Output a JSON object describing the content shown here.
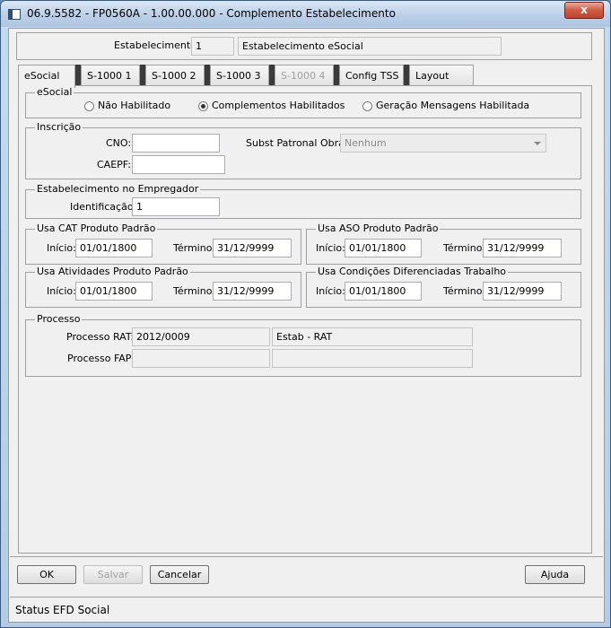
{
  "window": {
    "title": "06.9.5582 - FP0560A - 1.00.00.000 - Complemento Estabelecimento",
    "close_glyph": "x"
  },
  "header": {
    "estabelecimento_label": "Estabelecimento:",
    "estabelecimento_code": "1",
    "estabelecimento_name": "Estabelecimento eSocial"
  },
  "tabs": [
    {
      "label": "eSocial",
      "active": true,
      "disabled": false
    },
    {
      "label": "S-1000 1",
      "active": false,
      "disabled": false
    },
    {
      "label": "S-1000 2",
      "active": false,
      "disabled": false
    },
    {
      "label": "S-1000 3",
      "active": false,
      "disabled": false
    },
    {
      "label": "S-1000 4",
      "active": false,
      "disabled": true
    },
    {
      "label": "Config TSS",
      "active": false,
      "disabled": false
    },
    {
      "label": "Layout",
      "active": false,
      "disabled": false
    }
  ],
  "esocial_group": {
    "title": "eSocial",
    "options": [
      {
        "label": "Não Habilitado",
        "checked": false
      },
      {
        "label": "Complementos Habilitados",
        "checked": true
      },
      {
        "label": "Geração Mensagens Habilitada",
        "checked": false
      }
    ]
  },
  "inscricao": {
    "title": "Inscrição",
    "cno_label": "CNO:",
    "cno_value": "",
    "caepf_label": "CAEPF:",
    "caepf_value": "",
    "subst_label": "Subst Patronal Obra:",
    "subst_value": "Nenhum"
  },
  "empregador": {
    "title": "Estabelecimento no Empregador",
    "identificacao_label": "Identificação:",
    "identificacao_value": "1"
  },
  "cat": {
    "title": "Usa CAT Produto Padrão",
    "inicio_label": "Início:",
    "inicio": "01/01/1800",
    "termino_label": "Término:",
    "termino": "31/12/9999"
  },
  "aso": {
    "title": "Usa ASO Produto Padrão",
    "inicio_label": "Início:",
    "inicio": "01/01/1800",
    "termino_label": "Término:",
    "termino": "31/12/9999"
  },
  "atividades": {
    "title": "Usa Atividades Produto Padrão",
    "inicio_label": "Início:",
    "inicio": "01/01/1800",
    "termino_label": "Término:",
    "termino": "31/12/9999"
  },
  "condicoes": {
    "title": "Usa Condições Diferenciadas Trabalho",
    "inicio_label": "Início:",
    "inicio": "01/01/1800",
    "termino_label": "Término:",
    "termino": "31/12/9999"
  },
  "processo": {
    "title": "Processo",
    "rat_label": "Processo RAT:",
    "rat_code": "2012/0009",
    "rat_desc": "Estab - RAT",
    "fap_label": "Processo FAP:",
    "fap_code": "",
    "fap_desc": ""
  },
  "buttons": {
    "ok": "OK",
    "salvar": "Salvar",
    "cancelar": "Cancelar",
    "ajuda": "Ajuda"
  },
  "status": {
    "text": "Status EFD Social"
  }
}
